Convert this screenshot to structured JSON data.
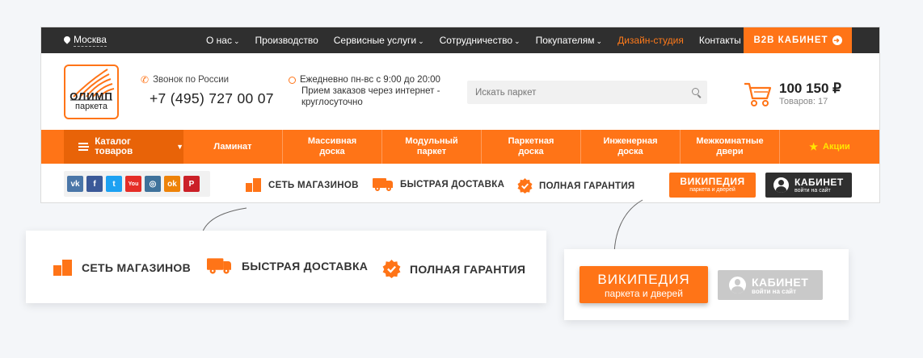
{
  "topbar": {
    "city": "Москва",
    "nav": [
      {
        "label": "О нас",
        "dropdown": true
      },
      {
        "label": "Производство",
        "dropdown": false
      },
      {
        "label": "Сервисные услуги",
        "dropdown": true
      },
      {
        "label": "Сотрудничество",
        "dropdown": true
      },
      {
        "label": "Покупателям",
        "dropdown": true
      },
      {
        "label": "Дизайн-студия",
        "dropdown": false,
        "accent": true
      },
      {
        "label": "Контакты",
        "dropdown": false
      }
    ],
    "b2b_label": "B2B КАБИНЕТ"
  },
  "header": {
    "logo_line1": "ОЛИМП",
    "logo_line2": "паркета",
    "phone_label": "Звонок по России",
    "phone_number": "+7 (495) 727 00 07",
    "hours_line1": "Ежедневно пн-вс с 9:00 до 20:00",
    "hours_line2": "Прием заказов через интернет - круглосуточно",
    "search_placeholder": "Искать паркет",
    "cart_total": "100 150 ₽",
    "cart_count": "Товаров: 17"
  },
  "catalog": {
    "button_label": "Каталог товаров",
    "items": [
      "Ламинат",
      "Массивная\nдоска",
      "Модульный\nпаркет",
      "Паркетная\nдоска",
      "Инженерная\nдоска",
      "Межкомнатные\nдвери"
    ],
    "promo_label": "Акции"
  },
  "features": {
    "stores": "СЕТЬ МАГАЗИНОВ",
    "delivery": "БЫСТРАЯ ДОСТАВКА",
    "warranty": "ПОЛНАЯ ГАРАНТИЯ"
  },
  "socials": [
    {
      "icon": "vk-icon",
      "glyph": "vk",
      "color": "#4a76a8"
    },
    {
      "icon": "facebook-icon",
      "glyph": "f",
      "color": "#3b5998"
    },
    {
      "icon": "twitter-icon",
      "glyph": "t",
      "color": "#1da1f2"
    },
    {
      "icon": "youtube-icon",
      "glyph": "You",
      "color": "#e52d27"
    },
    {
      "icon": "instagram-icon",
      "glyph": "◎",
      "color": "#3f729b"
    },
    {
      "icon": "odnoklassniki-icon",
      "glyph": "ok",
      "color": "#ee8208"
    },
    {
      "icon": "pinterest-icon",
      "glyph": "P",
      "color": "#cb2027"
    }
  ],
  "buttons": {
    "wiki_title": "ВИКИПЕДИЯ",
    "wiki_sub": "паркета и дверей",
    "cabinet_title": "КАБИНЕТ",
    "cabinet_sub": "войти на сайт"
  },
  "callout_buttons": {
    "wiki_title": "ВИКИПЕДИЯ",
    "wiki_sub": "паркета и дверей",
    "cabinet_title": "КАБИНЕТ",
    "cabinet_sub": "войти на сайт"
  },
  "colors": {
    "accent": "#ff7417",
    "dark": "#2f2f2f",
    "catalog_dark": "#e86308",
    "promo": "#ffe600",
    "disabled": "#c9c9c9"
  }
}
